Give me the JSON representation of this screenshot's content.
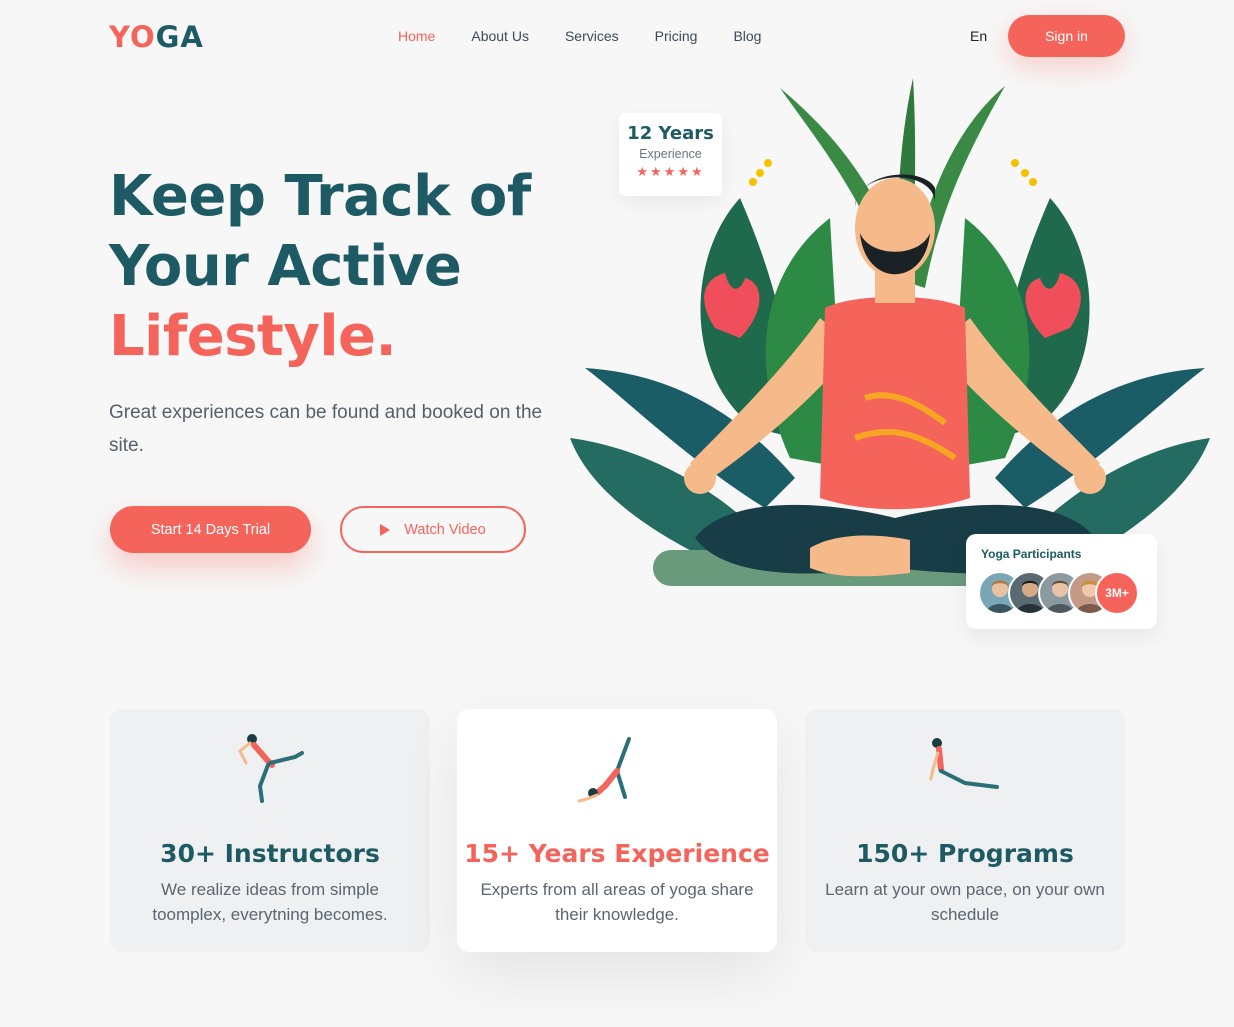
{
  "nav": {
    "logo_part1": "YO",
    "logo_part2": "GA",
    "items": [
      {
        "label": "Home",
        "active": true
      },
      {
        "label": "About Us"
      },
      {
        "label": "Services"
      },
      {
        "label": "Pricing"
      },
      {
        "label": "Blog"
      }
    ],
    "lang": "En",
    "signin_label": "Sign in"
  },
  "hero": {
    "title_line1": "Keep Track of",
    "title_line2": "Your Active",
    "title_line3": "Lifestyle.",
    "subtitle": "Great experiences can be found and booked on the site.",
    "trial_button": "Start 14 Days Trial",
    "watch_button": "Watch Video"
  },
  "experience_badge": {
    "years": "12 Years",
    "label": "Experience",
    "stars": "★★★★★",
    "rating": 5
  },
  "participants": {
    "title": "Yoga Participants",
    "count": "3M+"
  },
  "features": [
    {
      "title": "30+ Instructors",
      "text": "We realize ideas from simple toomplex, everytning becomes."
    },
    {
      "title": "15+ Years Experience",
      "text": "Experts from all areas of yoga share their knowledge."
    },
    {
      "title": "150+ Programs",
      "text": "Learn at your own pace, on your own schedule"
    }
  ],
  "colors": {
    "accent": "#f5645b",
    "primary": "#1d5a63",
    "background": "#f7f7f7"
  }
}
